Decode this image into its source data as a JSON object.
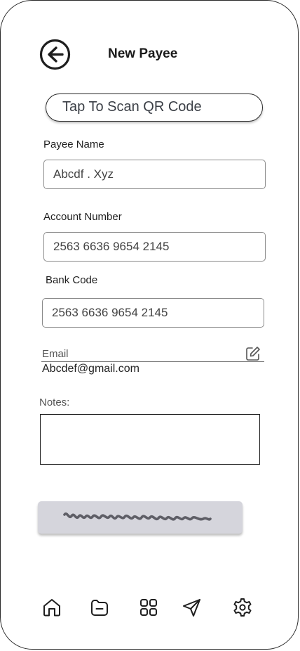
{
  "header": {
    "title": "New Payee"
  },
  "scan": {
    "label": "Tap To Scan QR Code"
  },
  "payee": {
    "label": "Payee Name",
    "value": "Abcdf .  Xyz"
  },
  "account": {
    "label": "Account Number",
    "value": "2563 6636 9654 2145"
  },
  "bank": {
    "label": "Bank Code",
    "value": "2563 6636 9654 2145"
  },
  "email": {
    "label": "Email",
    "value": "Abcdef@gmail.com"
  },
  "notes": {
    "label": "Notes:",
    "value": ""
  },
  "bottom_nav": {
    "items": [
      {
        "icon": "home-icon"
      },
      {
        "icon": "folder-minus-icon"
      },
      {
        "icon": "grid-icon"
      },
      {
        "icon": "send-icon"
      },
      {
        "icon": "settings-icon"
      }
    ]
  },
  "colors": {
    "button_bg": "#d5d5dc",
    "scribble": "#5e5e66",
    "stroke": "#1e1e1e"
  }
}
